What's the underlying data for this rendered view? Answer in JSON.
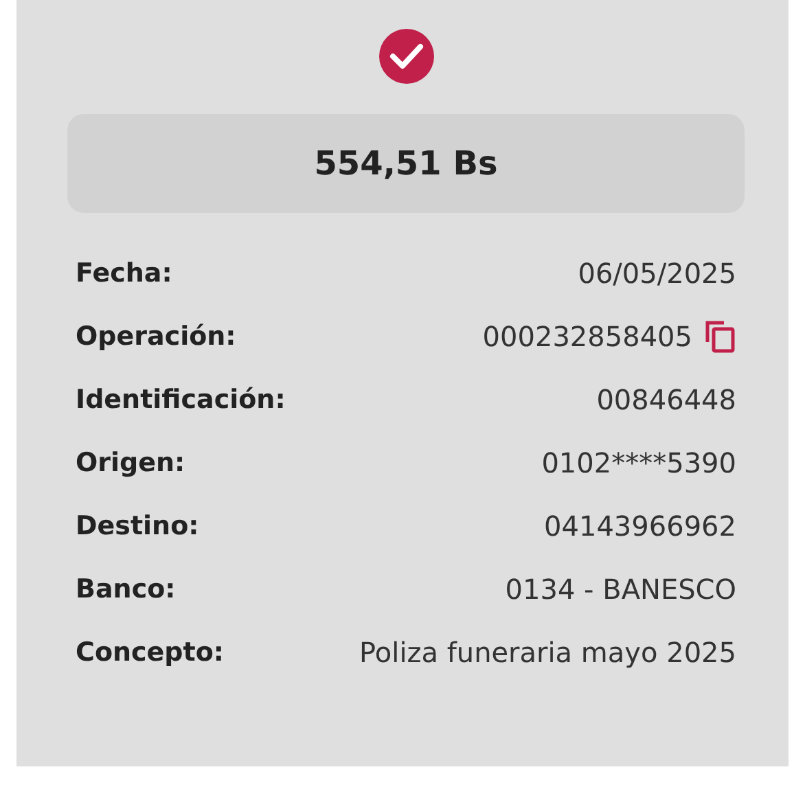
{
  "amount": "554,51 Bs",
  "details": [
    {
      "label": "Fecha:",
      "value": "06/05/2025",
      "copyable": false
    },
    {
      "label": "Operación:",
      "value": "000232858405",
      "copyable": true
    },
    {
      "label": "Identificación:",
      "value": "00846448",
      "copyable": false
    },
    {
      "label": "Origen:",
      "value": "0102****5390",
      "copyable": false
    },
    {
      "label": "Destino:",
      "value": "04143966962",
      "copyable": false
    },
    {
      "label": "Banco:",
      "value": "0134 - BANESCO",
      "copyable": false
    },
    {
      "label": "Concepto:",
      "value": "Poliza funeraria mayo 2025",
      "copyable": false
    }
  ]
}
